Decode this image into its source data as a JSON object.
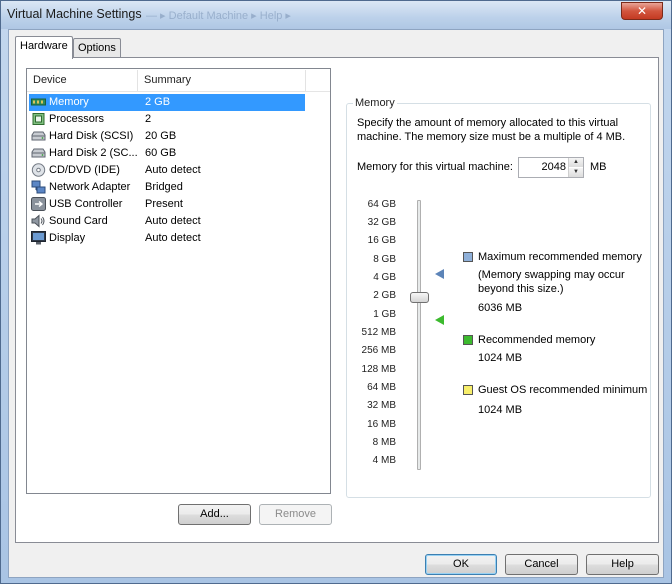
{
  "window": {
    "title": "Virtual Machine Settings",
    "background_title": "— ▸ Default Machine ▸ Help ▸",
    "close_label": "✕"
  },
  "tabs": [
    {
      "label": "Hardware",
      "active": true
    },
    {
      "label": "Options",
      "active": false
    }
  ],
  "device_list": {
    "columns": [
      "Device",
      "Summary"
    ],
    "rows": [
      {
        "name": "Memory",
        "summary": "2 GB",
        "icon": "memory-icon",
        "selected": true
      },
      {
        "name": "Processors",
        "summary": "2",
        "icon": "processor-icon",
        "selected": false
      },
      {
        "name": "Hard Disk (SCSI)",
        "summary": "20 GB",
        "icon": "hard-disk-icon",
        "selected": false
      },
      {
        "name": "Hard Disk 2 (SC...",
        "summary": "60 GB",
        "icon": "hard-disk-icon",
        "selected": false
      },
      {
        "name": "CD/DVD (IDE)",
        "summary": "Auto detect",
        "icon": "cd-dvd-icon",
        "selected": false
      },
      {
        "name": "Network Adapter",
        "summary": "Bridged",
        "icon": "network-adapter-icon",
        "selected": false
      },
      {
        "name": "USB Controller",
        "summary": "Present",
        "icon": "usb-icon",
        "selected": false
      },
      {
        "name": "Sound Card",
        "summary": "Auto detect",
        "icon": "sound-card-icon",
        "selected": false
      },
      {
        "name": "Display",
        "summary": "Auto detect",
        "icon": "display-icon",
        "selected": false
      }
    ]
  },
  "buttons": {
    "add": "Add...",
    "remove": "Remove",
    "ok": "OK",
    "cancel": "Cancel",
    "help": "Help"
  },
  "memory": {
    "group_title": "Memory",
    "description": "Specify the amount of memory allocated to this virtual machine. The memory size must be a multiple of 4 MB.",
    "field_label": "Memory for this virtual machine:",
    "value": "2048",
    "unit": "MB",
    "slider_ticks": [
      "64 GB",
      "32 GB",
      "16 GB",
      "8 GB",
      "4 GB",
      "2 GB",
      "1 GB",
      "512 MB",
      "256 MB",
      "128 MB",
      "64 MB",
      "32 MB",
      "16 MB",
      "8 MB",
      "4 MB"
    ],
    "slider_selected": "2 GB",
    "legend": {
      "max_title": "Maximum recommended memory",
      "max_note": "(Memory swapping may occur beyond this size.)",
      "max_value": "6036 MB",
      "rec_title": "Recommended memory",
      "rec_value": "1024 MB",
      "guest_title": "Guest OS recommended minimum",
      "guest_value": "1024 MB"
    }
  },
  "colors": {
    "selection": "#3399ff",
    "max_marker": "#5c84b8",
    "rec_marker": "#3cba2e",
    "guest_marker": "#f7ee6a"
  }
}
